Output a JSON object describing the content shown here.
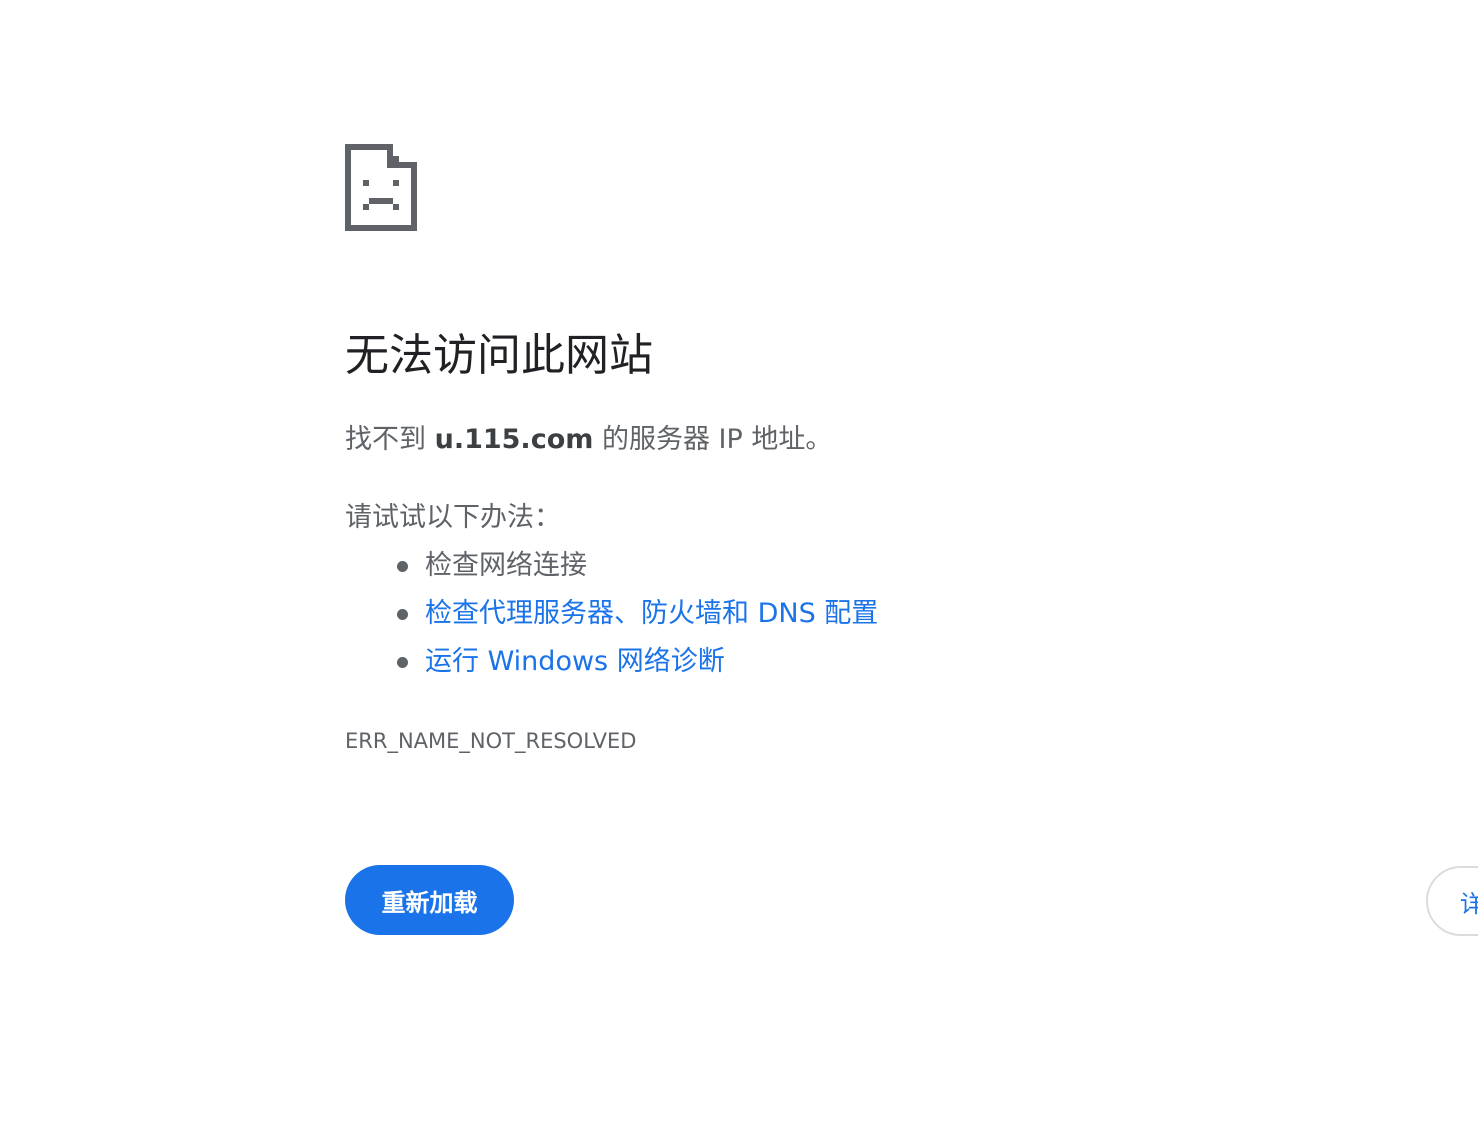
{
  "page": {
    "icon_name": "sad-document-icon",
    "title": "无法访问此网站",
    "summary_prefix": "找不到 ",
    "summary_host": "u.115.com",
    "summary_suffix": " 的服务器 IP 地址。",
    "suggestions_heading": "请试试以下办法：",
    "suggestions": [
      {
        "label": "检查网络连接",
        "link": false
      },
      {
        "label": "检查代理服务器、防火墙和 DNS 配置",
        "link": true
      },
      {
        "label": "运行 Windows 网络诊断",
        "link": true
      }
    ],
    "error_code": "ERR_NAME_NOT_RESOLVED",
    "reload_label": "重新加载",
    "details_label": "详细信息"
  },
  "colors": {
    "accent": "#1a73e8",
    "text": "#5f6368",
    "title": "#202124",
    "icon": "#5f6368"
  }
}
